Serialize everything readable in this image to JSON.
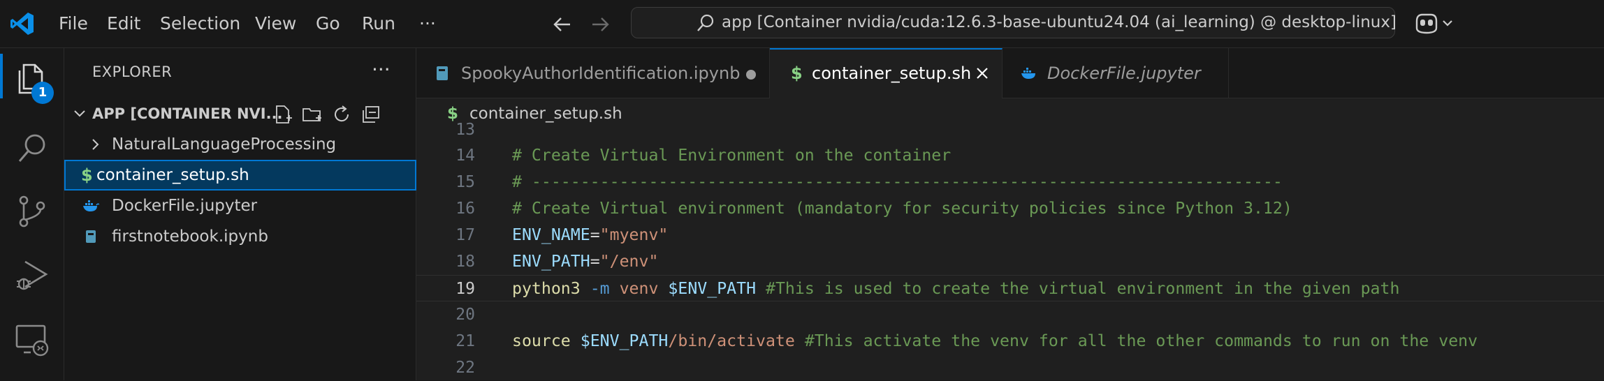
{
  "titlebar": {
    "menu": [
      "File",
      "Edit",
      "Selection",
      "View",
      "Go",
      "Run",
      "···"
    ],
    "command_center": "app [Container nvidia/cuda:12.6.3-base-ubuntu24.04 (ai_learning) @ desktop-linux]"
  },
  "activitybar": {
    "explorer_badge": "1",
    "icons": [
      "files-icon",
      "search-icon",
      "source-control-icon",
      "run-debug-icon",
      "remote-explorer-icon"
    ]
  },
  "sidebar": {
    "title": "EXPLORER",
    "more": "···",
    "section_title": "APP [CONTAINER NVI...",
    "items": [
      {
        "label": "NaturalLanguageProcessing",
        "type": "folder"
      },
      {
        "label": "container_setup.sh",
        "type": "shell",
        "selected": true
      },
      {
        "label": "DockerFile.jupyter",
        "type": "docker"
      },
      {
        "label": "firstnotebook.ipynb",
        "type": "notebook"
      }
    ]
  },
  "tabs": [
    {
      "label": "SpookyAuthorIdentification.ipynb",
      "modified": true
    },
    {
      "label": "container_setup.sh",
      "active": true
    },
    {
      "label": "DockerFile.jupyter",
      "preview": true
    }
  ],
  "breadcrumb": "container_setup.sh",
  "code": {
    "line_numbers": [
      "13",
      "14",
      "15",
      "16",
      "17",
      "18",
      "19",
      "20",
      "21",
      "22"
    ],
    "current_line": "19",
    "l14": "# Create Virtual Environment on the container",
    "l15": "# -----------------------------------------------------------------------------",
    "l16": "# Create Virtual environment (mandatory for security policies since Python 3.12)",
    "l17_var": "ENV_NAME",
    "l17_eq": "=",
    "l17_val": "\"myenv\"",
    "l18_var": "ENV_PATH",
    "l18_eq": "=",
    "l18_val": "\"/env\"",
    "l19_cmd": "python3",
    "l19_flag": "-m",
    "l19_arg": "venv",
    "l19_var": "$ENV_PATH",
    "l19_comment": "#This is used to create the virtual environment in the given path",
    "l21_cmd": "source",
    "l21_var": "$ENV_PATH",
    "l21_path": "/bin/activate",
    "l21_comment": "#This activate the venv for all the other commands to run on the venv"
  },
  "colors": {
    "accent": "#0078d4",
    "comment": "#6a9955",
    "variable": "#9cdcfe",
    "string": "#ce9178",
    "function": "#dcdcaa",
    "keyword": "#569cd6"
  }
}
